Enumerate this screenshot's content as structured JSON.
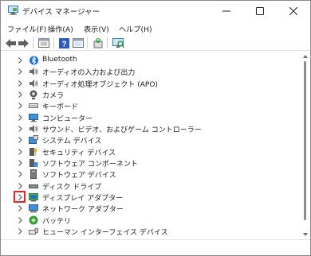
{
  "window": {
    "title": "デバイス マネージャー",
    "title_icon": "device-manager-icon",
    "controls": [
      "minimize-icon",
      "maximize-icon",
      "close-icon"
    ]
  },
  "menu": [
    {
      "label": "ファイル(F)"
    },
    {
      "label": "操作(A)"
    },
    {
      "label": "表示(V)"
    },
    {
      "label": "ヘルプ(H)"
    }
  ],
  "toolbar": [
    "back-arrow-icon",
    "forward-arrow-icon",
    "properties-icon",
    "help-icon",
    "action-icon",
    "update-driver-icon",
    "scan-hardware-icon"
  ],
  "tree": {
    "items": [
      {
        "label": "Bluetooth",
        "icon": "bluetooth-icon"
      },
      {
        "label": "オーディオの入力および出力",
        "icon": "speaker-icon"
      },
      {
        "label": "オーディオ処理オブジェクト (APO)",
        "icon": "speaker-icon"
      },
      {
        "label": "カメラ",
        "icon": "camera-icon"
      },
      {
        "label": "キーボード",
        "icon": "keyboard-icon"
      },
      {
        "label": "コンピューター",
        "icon": "computer-icon"
      },
      {
        "label": "サウンド、ビデオ、およびゲーム コントローラー",
        "icon": "speaker-icon"
      },
      {
        "label": "システム デバイス",
        "icon": "system-device-icon"
      },
      {
        "label": "セキュリティ デバイス",
        "icon": "security-device-icon"
      },
      {
        "label": "ソフトウェア コンポーネント",
        "icon": "software-component-icon"
      },
      {
        "label": "ソフトウェア デバイス",
        "icon": "software-device-icon"
      },
      {
        "label": "ディスク ドライブ",
        "icon": "disk-drive-icon"
      },
      {
        "label": "ディスプレイ アダプター",
        "icon": "display-adapter-icon",
        "highlighted": true
      },
      {
        "label": "ネットワーク アダプター",
        "icon": "network-adapter-icon"
      },
      {
        "label": "バッテリ",
        "icon": "battery-icon"
      },
      {
        "label": "ヒューマン インターフェイス デバイス",
        "icon": "hid-icon"
      }
    ],
    "highlight_color": "#e0262b"
  }
}
